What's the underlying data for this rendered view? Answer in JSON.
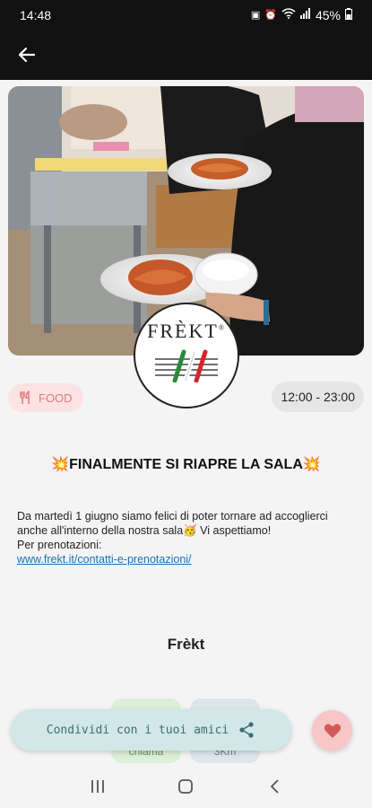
{
  "status_bar": {
    "time": "14:48",
    "battery": "45%",
    "icons": [
      "image-icon",
      "alarm-icon",
      "wifi-icon",
      "signal-icon",
      "battery-icon"
    ]
  },
  "app_bar": {
    "back_icon": "arrow-back-icon"
  },
  "logo": {
    "text": "FRÈKT",
    "mark": "®"
  },
  "chips": {
    "category_icon": "cutlery-icon",
    "category": "FOOD",
    "hours": "12:00 - 23:00"
  },
  "post": {
    "title": "💥FINALMENTE SI RIAPRE LA SALA💥",
    "body_line1": "Da martedì 1 giugno siamo felici di poter tornare ad accoglierci anche all'interno della nostra sala🥳 Vi aspettiamo!",
    "body_line2": "Per prenotazioni:",
    "link": "www.frekt.it/contatti-e-prenotazioni/"
  },
  "place": {
    "name": "Frèkt"
  },
  "actions": {
    "call": "chiama",
    "distance": "3Km"
  },
  "share": {
    "label": "Condividi con i tuoi amici",
    "icon": "share-icon"
  },
  "favorite": {
    "icon": "heart-icon"
  },
  "colors": {
    "food_chip_bg": "#fbe3e3",
    "food_chip_fg": "#e07a7a",
    "share_bg": "#d2e7e7",
    "share_fg": "#3f6e73",
    "heart": "#d45a5a",
    "link": "#1f6fb5"
  },
  "nav": {
    "icons": [
      "recent-apps-icon",
      "home-icon",
      "back-icon"
    ]
  }
}
